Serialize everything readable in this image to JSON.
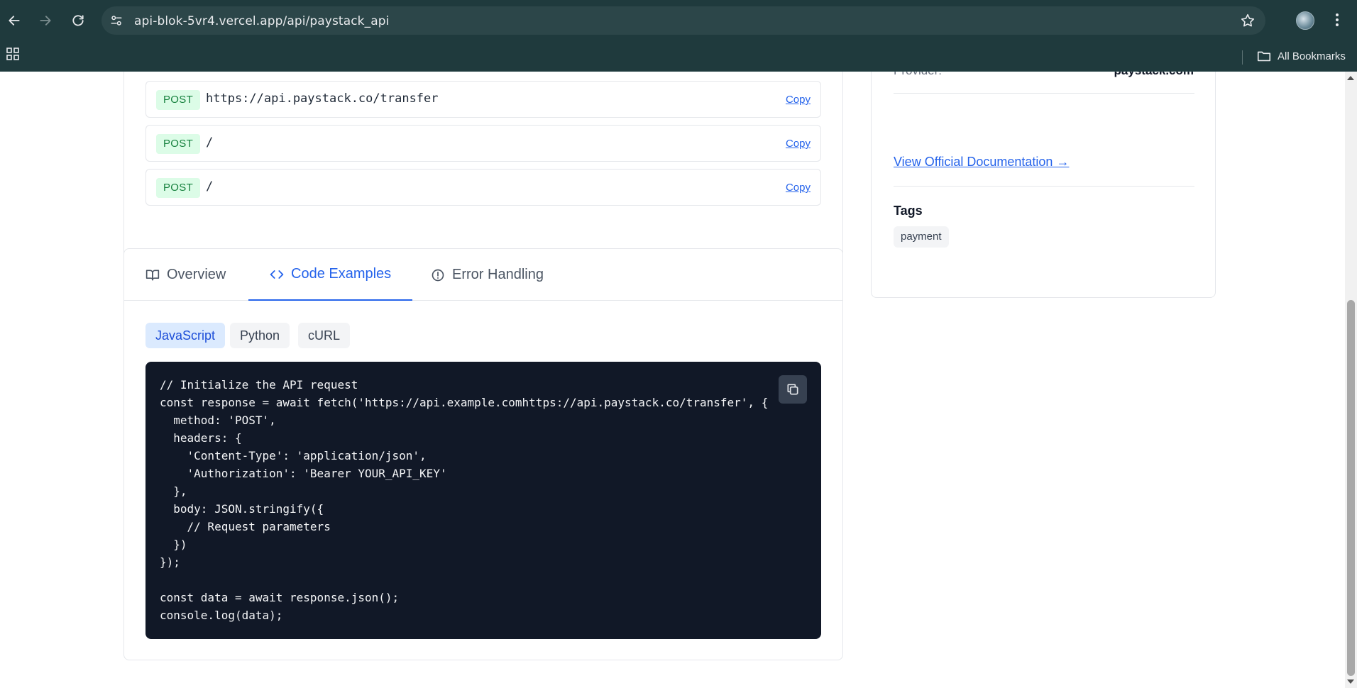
{
  "browser": {
    "url": "api-blok-5vr4.vercel.app/api/paystack_api",
    "bookmarks_label": "All Bookmarks"
  },
  "endpoints": [
    {
      "method": "POST",
      "path": "https://api.paystack.co/transfer",
      "copy_label": "Copy"
    },
    {
      "method": "POST",
      "path": "/",
      "copy_label": "Copy"
    },
    {
      "method": "POST",
      "path": "/",
      "copy_label": "Copy"
    }
  ],
  "sidebar": {
    "provider_label": "Provider:",
    "provider_value": "paystack.com",
    "doc_link": "View Official Documentation →",
    "tags_title": "Tags",
    "tags": [
      "payment"
    ]
  },
  "tabs": [
    {
      "label": "Overview",
      "icon": "book-open-icon",
      "active": false
    },
    {
      "label": "Code Examples",
      "icon": "code-icon",
      "active": true
    },
    {
      "label": "Error Handling",
      "icon": "alert-circle-icon",
      "active": false
    }
  ],
  "languages": [
    {
      "label": "JavaScript",
      "active": true
    },
    {
      "label": "Python",
      "active": false
    },
    {
      "label": "cURL",
      "active": false
    }
  ],
  "code": {
    "text": "// Initialize the API request\nconst response = await fetch('https://api.example.comhttps://api.paystack.co/transfer', {\n  method: 'POST',\n  headers: {\n    'Content-Type': 'application/json',\n    'Authorization': 'Bearer YOUR_API_KEY'\n  },\n  body: JSON.stringify({\n    // Request parameters\n  })\n});\n\nconst data = await response.json();\nconsole.log(data);"
  },
  "colors": {
    "chrome_bg": "#1f3a3d",
    "accent": "#2563eb",
    "method_bg": "#dcfce7",
    "method_text": "#15803d",
    "code_bg": "#111827"
  }
}
